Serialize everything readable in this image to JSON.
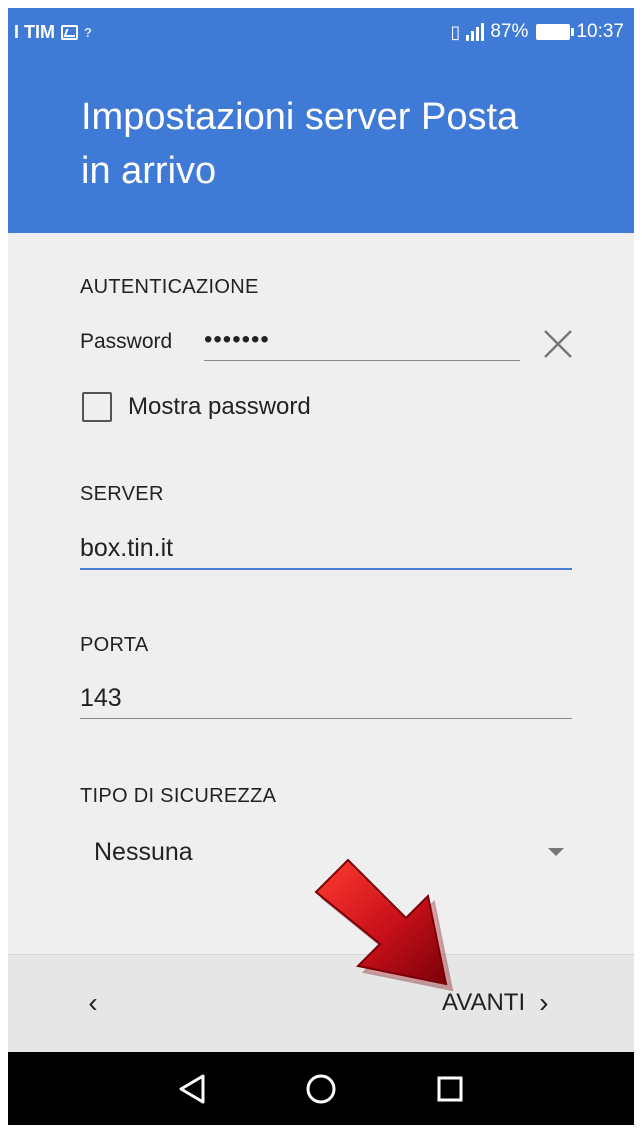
{
  "status_bar": {
    "carrier": "I TIM",
    "battery_percent": "87%",
    "time": "10:37"
  },
  "header": {
    "title_line1": "Impostazioni server Posta",
    "title_line2": "in arrivo"
  },
  "authentication": {
    "section_label": "AUTENTICAZIONE",
    "password_label": "Password",
    "password_value": "•••••••",
    "show_password_label": "Mostra password"
  },
  "server": {
    "section_label": "SERVER",
    "value": "box.tin.it"
  },
  "port": {
    "section_label": "PORTA",
    "value": "143"
  },
  "security": {
    "section_label": "TIPO DI SICUREZZA",
    "selected": "Nessuna"
  },
  "bottom_bar": {
    "back_glyph": "‹",
    "next_label": "AVANTI",
    "next_glyph": "›"
  },
  "colors": {
    "primary": "#3f7bd6",
    "accent_line": "#4a7fd9",
    "background": "#efefef",
    "annotation_arrow": "#c8101a"
  }
}
